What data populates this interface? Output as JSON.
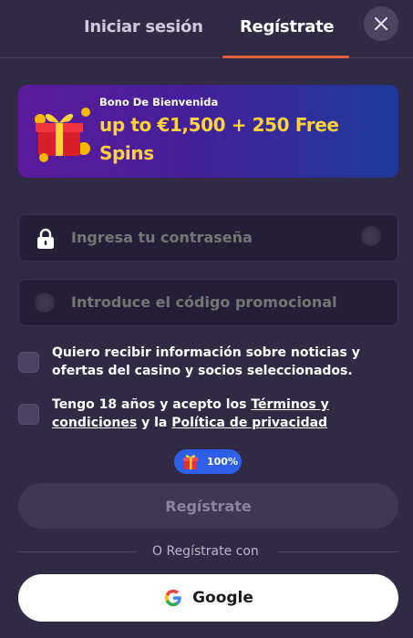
{
  "tabs": {
    "login": "Iniciar sesión",
    "register": "Regístrate"
  },
  "banner": {
    "subtitle": "Bono De Bienvenida",
    "title": "up to €1,500 + 250 Free Spins"
  },
  "fields": {
    "password_placeholder": "Ingresa tu contraseña",
    "promo_placeholder": "Introduce el código promocional"
  },
  "consent": {
    "marketing": "Quiero recibir información sobre noticias y ofertas del casino y socios seleccionados.",
    "age_prefix": "Tengo 18 años y acepto los ",
    "terms_link": "Términos y condiciones",
    "age_middle": " y la ",
    "privacy_link": "Política de privacidad"
  },
  "badge": {
    "text": "100%"
  },
  "submit_label": "Regístrate",
  "divider_text": "O Regístrate con",
  "google_label": "Google",
  "colors": {
    "background": "#302a45",
    "accent_underline": "#e0613a",
    "banner_title": "#ffd23c",
    "badge": "#2f5fe8"
  },
  "icons": {
    "close": "close-icon",
    "lock": "lock-icon",
    "gift": "gift-icon",
    "google": "google-icon"
  }
}
